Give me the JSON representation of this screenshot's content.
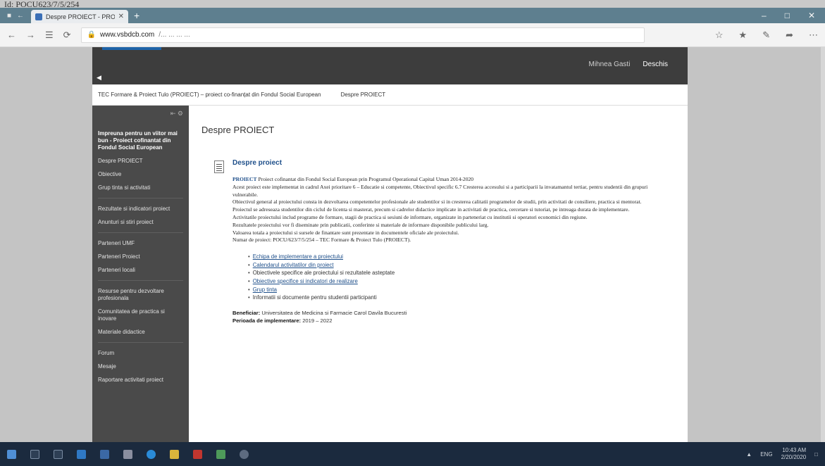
{
  "scan_label": "Id: POCU623/7/5/254",
  "browser": {
    "tab_title": "Despre PROIECT - PROI",
    "url_host": "www.vsbdcb.com",
    "url_rest": "/... ... ... ..."
  },
  "site": {
    "header_links": [
      "Mihnea Gasti",
      "Deschis"
    ],
    "breadcrumb": [
      "TEC Formare & Proiect Tulo (PROIECT) – proiect co-finanțat din Fondul Social European",
      "Despre PROIECT"
    ],
    "sidebar": [
      {
        "label": "Impreuna pentru un viitor mai bun - Proiect cofinantat din Fondul Social European",
        "active": true
      },
      {
        "label": "Despre PROIECT",
        "active": false
      },
      {
        "label": "Obiective",
        "active": false
      },
      {
        "label": "Grup tinta si activitati",
        "active": false
      },
      {
        "sep": true
      },
      {
        "label": "Rezultate si indicatori proiect",
        "active": false
      },
      {
        "label": "Anunturi si stiri proiect",
        "active": false
      },
      {
        "sep": true
      },
      {
        "label": "Parteneri UMF",
        "active": false
      },
      {
        "label": "Parteneri Proiect",
        "active": false
      },
      {
        "label": "Parteneri locali",
        "active": false
      },
      {
        "sep": true
      },
      {
        "label": "Resurse pentru dezvoltare profesionala",
        "active": false
      },
      {
        "label": "Comunitatea de practica si inovare",
        "active": false
      },
      {
        "label": "Materiale didactice",
        "active": false
      },
      {
        "sep": true
      },
      {
        "label": "Forum",
        "active": false
      },
      {
        "label": "Mesaje",
        "active": false
      },
      {
        "label": "Raportare activitati proiect",
        "active": false
      }
    ],
    "page_title": "Despre PROIECT",
    "section_title": "Despre proiect",
    "paragraphs": [
      {
        "code": "PROIECT",
        "text": " Proiect cofinantat din Fondul Social European prin Programul Operational Capital Uman 2014-2020"
      },
      {
        "code": "",
        "text": "Acest proiect este implementat in cadrul Axei prioritare 6 – Educatie si competente, Obiectivul specific 6.7 Cresterea accesului si a participarii la invatamantul tertiar, pentru studentii din grupuri vulnerabile."
      },
      {
        "code": "",
        "text": "Obiectivul general al proiectului consta in dezvoltarea competentelor profesionale ale studentilor si in cresterea calitatii programelor de studii, prin activitati de consiliere, practica si mentorat."
      },
      {
        "code": "",
        "text": "Proiectul se adreseaza studentilor din ciclul de licenta si masterat, precum si cadrelor didactice implicate in activitati de practica, cercetare si tutoriat, pe intreaga durata de implementare."
      },
      {
        "code": "",
        "text": "Activitatile proiectului includ programe de formare, stagii de practica si sesiuni de informare, organizate in parteneriat cu institutii si operatori economici din regiune."
      },
      {
        "code": "",
        "text": "Rezultatele proiectului vor fi diseminate prin publicatii, conferinte si materiale de informare disponibile publicului larg."
      },
      {
        "code": "",
        "text": "Valoarea totala a proiectului si sursele de finantare sunt prezentate in documentele oficiale ale proiectului."
      },
      {
        "code": "",
        "text": "Numar de proiect: POCU/623/7/5/254 – TEC Formare & Proiect Tulo (PROIECT)."
      }
    ],
    "links": [
      {
        "label": "Echipa de implementare a proiectului",
        "link": true
      },
      {
        "label": "Calendarul activitatilor din proiect",
        "link": true
      },
      {
        "label": "Obiectivele specifice ale proiectului si rezultatele asteptate",
        "link": false
      },
      {
        "label": "Obiective specifice si indicatori de realizare",
        "link": true
      },
      {
        "label": "Grup tinta",
        "link": true
      },
      {
        "label": "Informatii si documente pentru studentii participanti",
        "link": false
      }
    ],
    "footer_lines": [
      {
        "label": "Beneficiar:",
        "value": " Universitatea de Medicina si Farmacie Carol Davila Bucuresti"
      },
      {
        "label": "Perioada de implementare:",
        "value": " 2019 – 2022"
      }
    ]
  },
  "colors": {
    "header": "#3d3d3d",
    "sidebar": "#4a4a4a",
    "link": "#1e4f8a",
    "taskbar": "#1b2a3e"
  },
  "taskbar": {
    "clock_time": "10:43 AM",
    "clock_date": "2/20/2020",
    "tray_text": "ENG"
  }
}
